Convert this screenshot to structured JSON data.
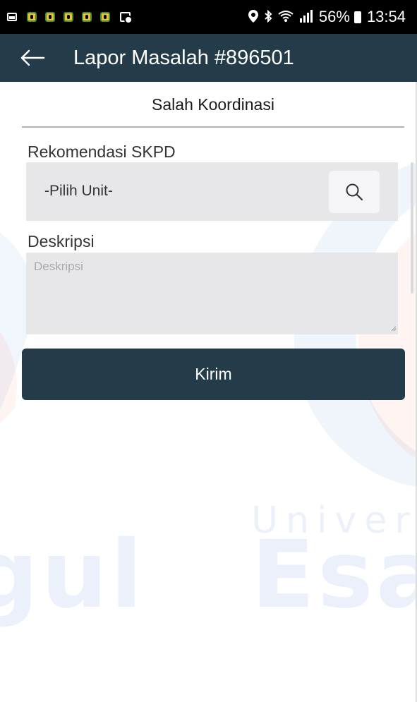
{
  "status_bar": {
    "battery": "56%",
    "time": "13:54",
    "left_icons": [
      "gallery-icon",
      "notification-icon",
      "notification-icon",
      "notification-icon",
      "notification-icon",
      "notification-icon",
      "screen-recorder-icon"
    ],
    "right_icons": [
      "location-icon",
      "bluetooth-icon",
      "wifi-icon",
      "signal-icon",
      "battery-icon"
    ]
  },
  "app_bar": {
    "title": "Lapor Masalah #896501",
    "back_icon": "arrow-left-icon",
    "background_color": "#243c49"
  },
  "form": {
    "section_title": "Salah Koordinasi",
    "skpd": {
      "label": "Rekomendasi SKPD",
      "value": "-Pilih Unit-",
      "search_icon": "search-icon"
    },
    "description": {
      "label": "Deskripsi",
      "placeholder": "Deskripsi",
      "value": ""
    },
    "submit_label": "Kirim",
    "submit_color": "#243c49"
  },
  "watermark": {
    "text_top": "Universit",
    "text_bottom_right": "Esa U",
    "text_bottom_left": "gul"
  }
}
